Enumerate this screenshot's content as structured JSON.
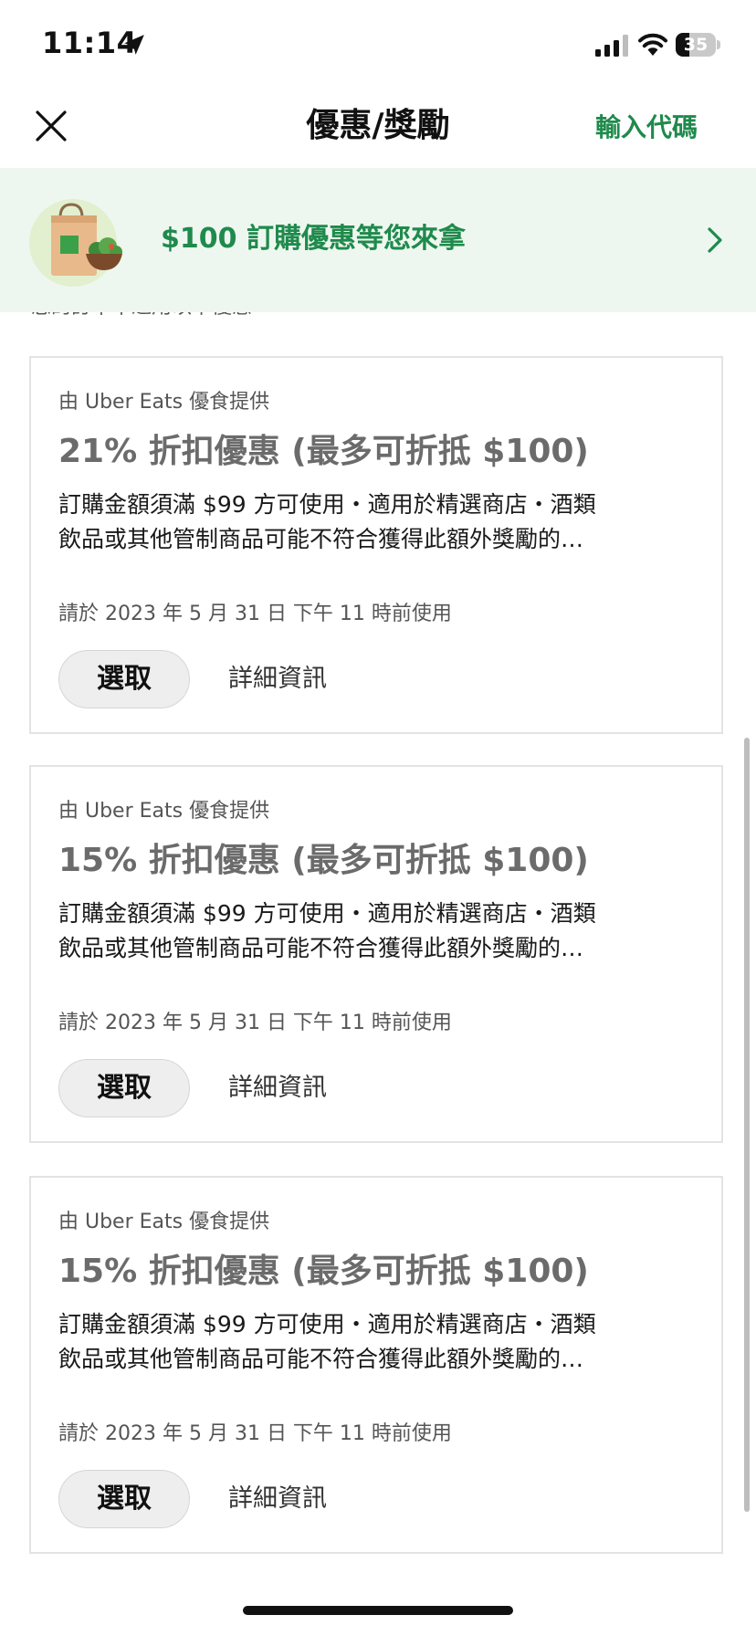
{
  "status_bar": {
    "time": "11:14",
    "battery_level": "35",
    "battery_fraction": 0.35
  },
  "header": {
    "title": "優惠/獎勵",
    "enter_code_label": "輸入代碼"
  },
  "promo_banner": {
    "text": "$100 訂購優惠等您來拿"
  },
  "clipped_notice": "您的訂單不適用以下優惠",
  "offers": [
    {
      "provider": "由 Uber Eats 優食提供",
      "title": "21% 折扣優惠 (最多可折抵 $100)",
      "description_line1": "訂購金額須滿 $99 方可使用・適用於精選商店・酒類",
      "description_line2": "飲品或其他管制商品可能不符合獲得此額外獎勵的…",
      "expiry": "請於 2023 年 5 月 31 日 下午 11 時前使用",
      "select_label": "選取",
      "details_label": "詳細資訊"
    },
    {
      "provider": "由 Uber Eats 優食提供",
      "title": "15% 折扣優惠 (最多可折抵 $100)",
      "description_line1": "訂購金額須滿 $99 方可使用・適用於精選商店・酒類",
      "description_line2": "飲品或其他管制商品可能不符合獲得此額外獎勵的…",
      "expiry": "請於 2023 年 5 月 31 日 下午 11 時前使用",
      "select_label": "選取",
      "details_label": "詳細資訊"
    },
    {
      "provider": "由 Uber Eats 優食提供",
      "title": "15% 折扣優惠 (最多可折抵 $100)",
      "description_line1": "訂購金額須滿 $99 方可使用・適用於精選商店・酒類",
      "description_line2": "飲品或其他管制商品可能不符合獲得此額外獎勵的…",
      "expiry": "請於 2023 年 5 月 31 日 下午 11 時前使用",
      "select_label": "選取",
      "details_label": "詳細資訊"
    }
  ],
  "colors": {
    "accent_green": "#1f8a4c",
    "banner_bg": "#eef7ef"
  },
  "icons": [
    "location-arrow-icon",
    "signal-icon",
    "wifi-icon",
    "battery-icon",
    "close-icon",
    "grocery-bag-icon",
    "chevron-right-icon"
  ]
}
